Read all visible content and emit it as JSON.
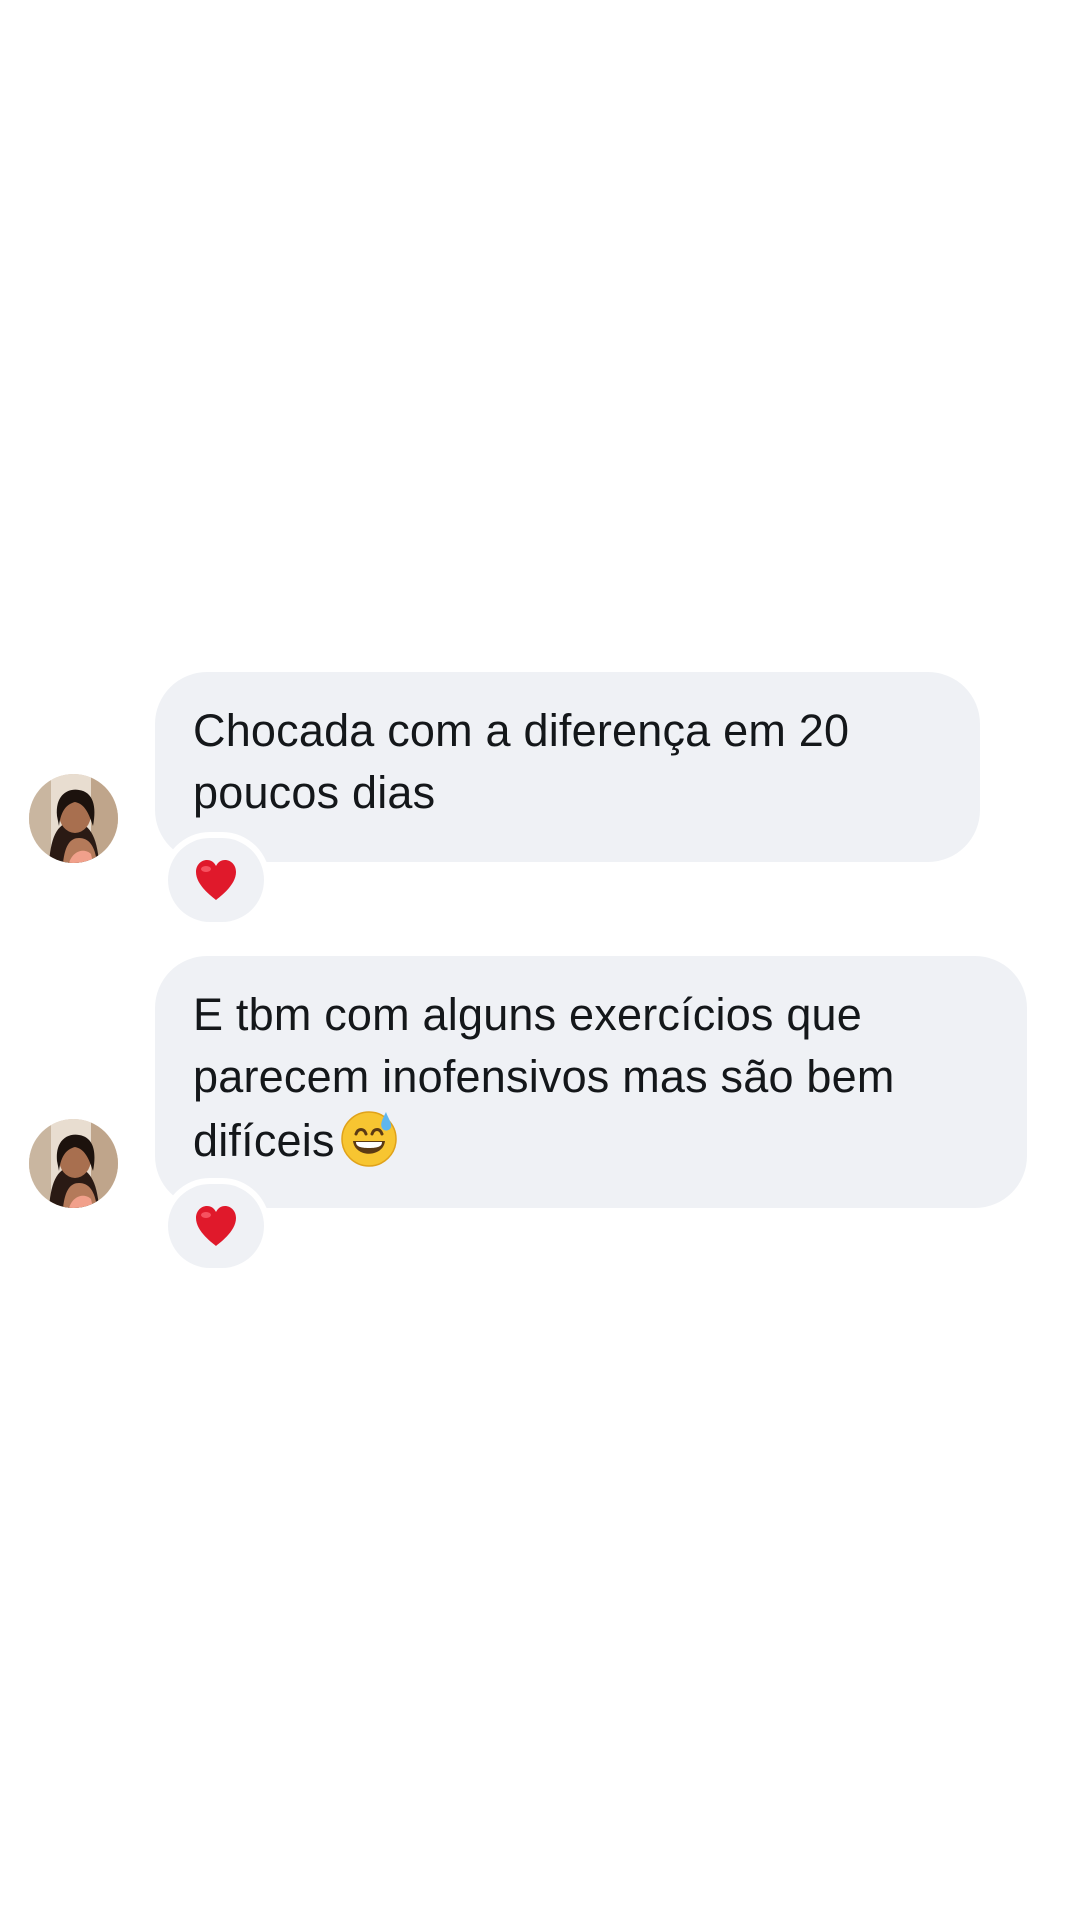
{
  "thread": {
    "messages": [
      {
        "text": "Chocada com a diferença em 20\npoucos dias",
        "reaction": "heart-icon",
        "avatar": "avatar-photo"
      },
      {
        "text": "E tbm com alguns exercícios que\nparecem inofensivos mas são bem\ndifíceis",
        "trailing_emoji": "grinning-sweat-emoji",
        "reaction": "heart-icon",
        "avatar": "avatar-photo"
      }
    ]
  },
  "colors": {
    "background": "#ffffff",
    "bubble": "#eff1f5",
    "text": "#14171a",
    "heart": "#e0192b"
  }
}
